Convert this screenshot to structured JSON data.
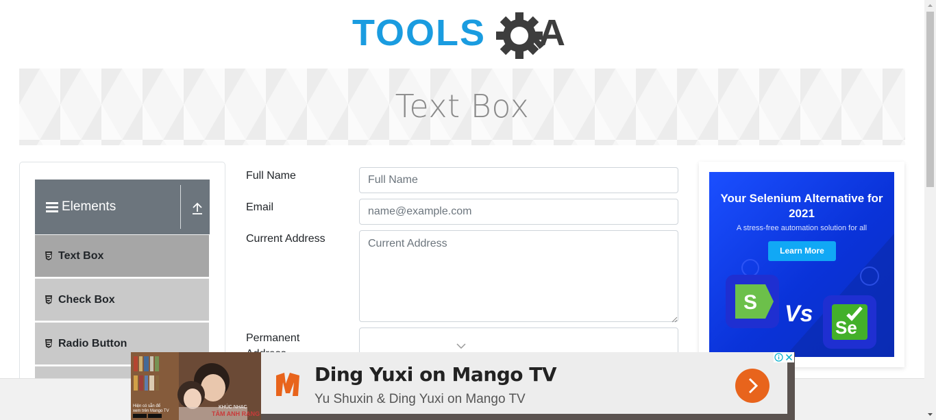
{
  "header": {
    "logo_text_primary": "TOOLS",
    "logo_text_secondary": "QA",
    "logo_colors": {
      "primary": "#1a9ce0",
      "secondary": "#3d3d3d"
    }
  },
  "banner": {
    "title": "Text Box"
  },
  "sidebar": {
    "group": {
      "label": "Elements",
      "menu_icon": "hamburger-icon",
      "collapse_icon": "upload-arrow-icon"
    },
    "items": [
      {
        "label": "Text Box",
        "icon": "html5-icon",
        "active": true
      },
      {
        "label": "Check Box",
        "icon": "html5-icon",
        "active": false
      },
      {
        "label": "Radio Button",
        "icon": "html5-icon",
        "active": false
      }
    ]
  },
  "form": {
    "full_name": {
      "label": "Full Name",
      "placeholder": "Full Name",
      "value": ""
    },
    "email": {
      "label": "Email",
      "placeholder": "name@example.com",
      "value": ""
    },
    "current_address": {
      "label": "Current Address",
      "placeholder": "Current Address",
      "value": ""
    },
    "permanent_address": {
      "label": "Permanent\nAddress",
      "placeholder": "",
      "value": ""
    }
  },
  "right_ad": {
    "headline": "Your Selenium Alternative for 2021",
    "subtext": "A stress-free automation solution for all",
    "button_label": "Learn More",
    "vs_text": "Vs",
    "left_logo_letter": "S",
    "right_logo_letters": "Se",
    "colors": {
      "background": "#0a33d9",
      "button": "#11a8f5",
      "s_logo": "#6cc04a",
      "se_logo": "#43b02a"
    }
  },
  "bottom_ad": {
    "title": "Ding Yuxi on Mango TV",
    "subtitle": "Yu Shuxin & Ding Yuxi on Mango TV",
    "image_caption_line1": "Hiện có sẵn để",
    "image_caption_line2": "xem trên Mango TV",
    "image_overlay_title_1": "KHÚC NHẠC",
    "image_overlay_title_2": "TÂM ANH RẠNG",
    "info_icon": "info-icon",
    "close_icon": "close-icon",
    "go_icon": "chevron-right-icon",
    "colors": {
      "logo": "#e8641c",
      "go_button": "#e8641c"
    }
  }
}
